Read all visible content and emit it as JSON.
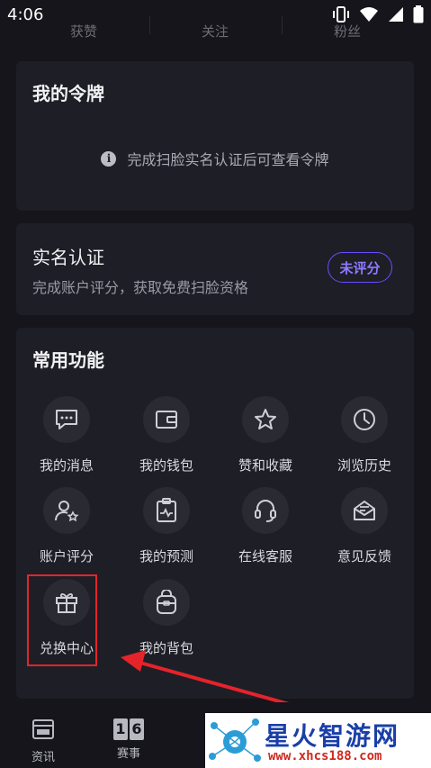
{
  "status": {
    "time": "4:06"
  },
  "stats": [
    "获赞",
    "关注",
    "粉丝"
  ],
  "token_card": {
    "title": "我的令牌",
    "note": "完成扫脸实名认证后可查看令牌"
  },
  "realname_card": {
    "title": "实名认证",
    "subtitle": "完成账户评分，获取免费扫脸资格",
    "badge": "未评分"
  },
  "functions": {
    "title": "常用功能",
    "items": [
      {
        "label": "我的消息",
        "icon": "message-icon"
      },
      {
        "label": "我的钱包",
        "icon": "wallet-icon"
      },
      {
        "label": "赞和收藏",
        "icon": "star-icon"
      },
      {
        "label": "浏览历史",
        "icon": "clock-icon"
      },
      {
        "label": "账户评分",
        "icon": "user-star-icon"
      },
      {
        "label": "我的预测",
        "icon": "clipboard-chart-icon"
      },
      {
        "label": "在线客服",
        "icon": "headset-icon"
      },
      {
        "label": "意见反馈",
        "icon": "mail-feedback-icon"
      },
      {
        "label": "兑换中心",
        "icon": "gift-icon"
      },
      {
        "label": "我的背包",
        "icon": "backpack-icon"
      }
    ]
  },
  "tabbar": [
    {
      "label": "资讯",
      "icon": "news-icon"
    },
    {
      "label": "赛事",
      "icon": "scoreboard-icon",
      "glyph": "16"
    }
  ],
  "watermark": {
    "text": "星火智游网",
    "url": "www.xhcs188.com"
  },
  "colors": {
    "accent": "#6a4dff",
    "highlight": "#e5232a"
  }
}
